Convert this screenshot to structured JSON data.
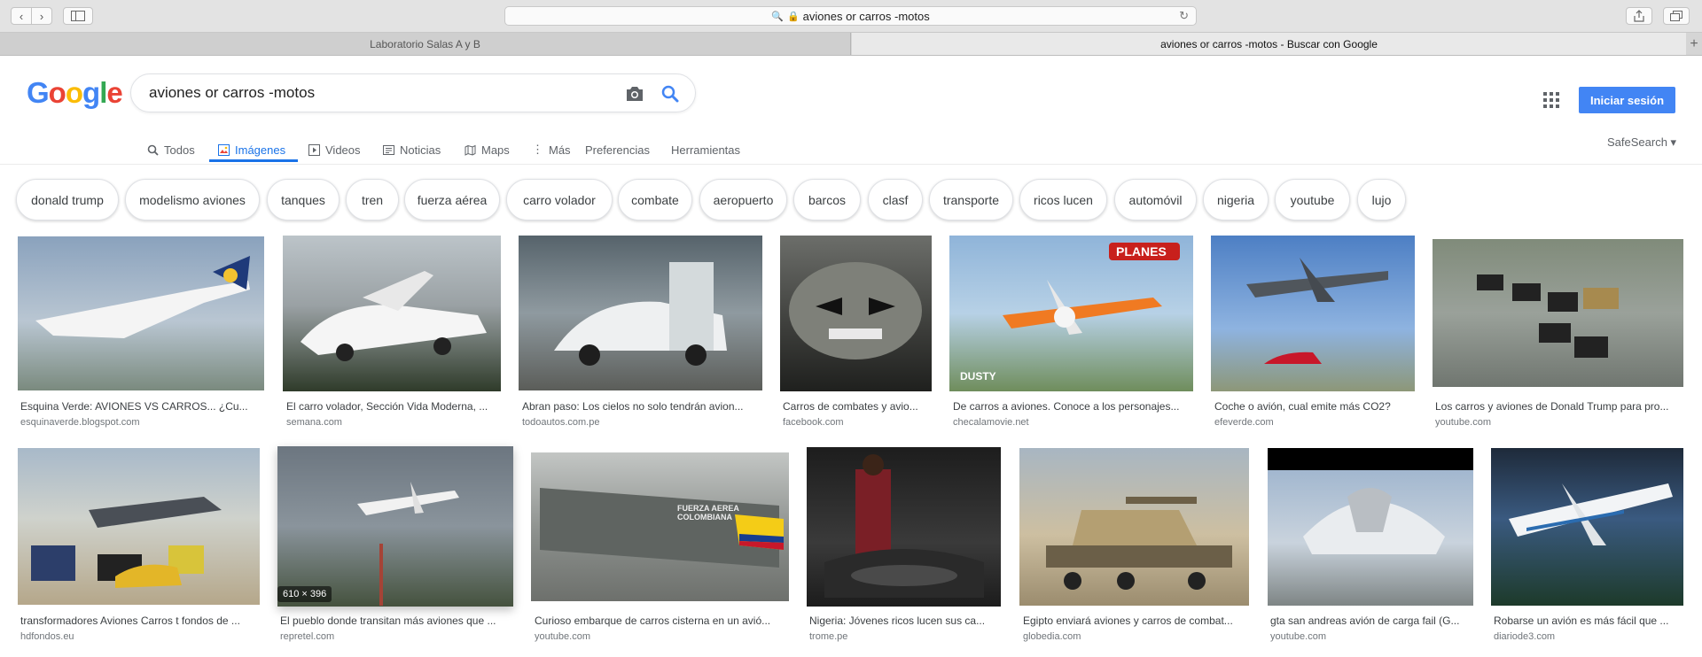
{
  "browser": {
    "url": "aviones or carros -motos",
    "tabs": [
      {
        "label": "Laboratorio Salas A y B"
      },
      {
        "label": "aviones or carros -motos - Buscar con Google"
      }
    ]
  },
  "google": {
    "logo_letters": [
      "G",
      "o",
      "o",
      "g",
      "l",
      "e"
    ],
    "logo_colors": [
      "#4285f4",
      "#ea4335",
      "#fbbc05",
      "#4285f4",
      "#34a853",
      "#ea4335"
    ],
    "query": "aviones or carros -motos",
    "signin_label": "Iniciar sesión",
    "safesearch_label": "SafeSearch ▾"
  },
  "nav": {
    "items": [
      {
        "label": "Todos",
        "icon": "search-icon"
      },
      {
        "label": "Imágenes",
        "icon": "image-icon"
      },
      {
        "label": "Videos",
        "icon": "video-icon"
      },
      {
        "label": "Noticias",
        "icon": "news-icon"
      },
      {
        "label": "Maps",
        "icon": "map-icon"
      },
      {
        "label": "Más",
        "icon": "more-icon"
      },
      {
        "label": "Preferencias"
      },
      {
        "label": "Herramientas"
      }
    ]
  },
  "chips": [
    "donald trump",
    "modelismo aviones",
    "tanques",
    "tren",
    "fuerza aérea",
    "carro volador",
    "combate",
    "aeropuerto",
    "barcos",
    "clasf",
    "transporte",
    "ricos lucen",
    "automóvil",
    "nigeria",
    "youtube",
    "lujo"
  ],
  "results": {
    "row1": [
      {
        "caption": "Esquina Verde: AVIONES VS CARROS... ¿Cu...",
        "source": "esquinaverde.blogspot.com"
      },
      {
        "caption": "El carro volador, Sección Vida Moderna, ...",
        "source": "semana.com"
      },
      {
        "caption": "Abran paso: Los cielos no solo tendrán avion...",
        "source": "todoautos.com.pe"
      },
      {
        "caption": "Carros de combates y avio...",
        "source": "facebook.com"
      },
      {
        "caption": "De carros a aviones. Conoce a los personajes...",
        "source": "checalamovie.net",
        "overlay": "PLANES",
        "overlay2": "DUSTY"
      },
      {
        "caption": "Coche o avión, cual emite más CO2?",
        "source": "efeverde.com"
      },
      {
        "caption": "Los carros y aviones de Donald Trump para pro...",
        "source": "youtube.com"
      }
    ],
    "row2": [
      {
        "caption": "transformadores Aviones Carros t fondos de ...",
        "source": "hdfondos.eu"
      },
      {
        "caption": "El pueblo donde transitan más aviones que ...",
        "source": "repretel.com",
        "dims": "610 × 396"
      },
      {
        "caption": "Curioso embarque de carros cisterna en un avió...",
        "source": "youtube.com",
        "overlay": "FUERZA AEREA COLOMBIANA"
      },
      {
        "caption": "Nigeria: Jóvenes ricos lucen sus ca...",
        "source": "trome.pe"
      },
      {
        "caption": "Egipto enviará aviones y carros de combat...",
        "source": "globedia.com"
      },
      {
        "caption": "gta san andreas avión de carga fail (G...",
        "source": "youtube.com"
      },
      {
        "caption": "Robarse un avión es más fácil que ...",
        "source": "diariode3.com"
      }
    ]
  }
}
